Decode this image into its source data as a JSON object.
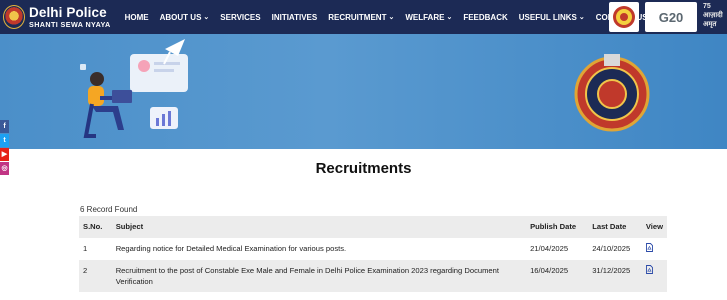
{
  "header": {
    "logo_title": "Delhi Police",
    "logo_subtitle": "SHANTI SEWA NYAYA",
    "nav": [
      {
        "label": "HOME",
        "dropdown": false
      },
      {
        "label": "ABOUT US",
        "dropdown": true
      },
      {
        "label": "SERVICES",
        "dropdown": false
      },
      {
        "label": "INITIATIVES",
        "dropdown": false
      },
      {
        "label": "RECRUITMENT",
        "dropdown": true
      },
      {
        "label": "WELFARE",
        "dropdown": true
      },
      {
        "label": "FEEDBACK",
        "dropdown": false
      },
      {
        "label": "USEFUL LINKS",
        "dropdown": true
      },
      {
        "label": "CONTACT US",
        "dropdown": true
      }
    ],
    "badge_g20": "G20",
    "amrit_text": "75 आज़ादी अमृत"
  },
  "colors": {
    "header_bg": "#1c2a55",
    "banner_bg": "#4b8fc9",
    "row_alt": "#ececec"
  },
  "social": {
    "facebook": "f",
    "twitter": "t",
    "youtube": "▶",
    "instagram": "◎"
  },
  "page": {
    "title": "Recruitments",
    "record_count": "6 Record Found"
  },
  "table": {
    "headers": {
      "sno": "S.No.",
      "subject": "Subject",
      "publish": "Publish Date",
      "last": "Last Date",
      "view": "View"
    },
    "rows": [
      {
        "sno": "1",
        "subject": "Regarding notice for Detailed Medical Examination for various posts.",
        "publish": "21/04/2025",
        "last": "24/10/2025",
        "view_icon": "pdf-icon"
      },
      {
        "sno": "2",
        "subject": "Recruitment to the post of Constable Exe Male and Female in Delhi Police Examination 2023 regarding Document Verification",
        "publish": "16/04/2025",
        "last": "31/12/2025",
        "view_icon": "pdf-icon"
      }
    ]
  }
}
